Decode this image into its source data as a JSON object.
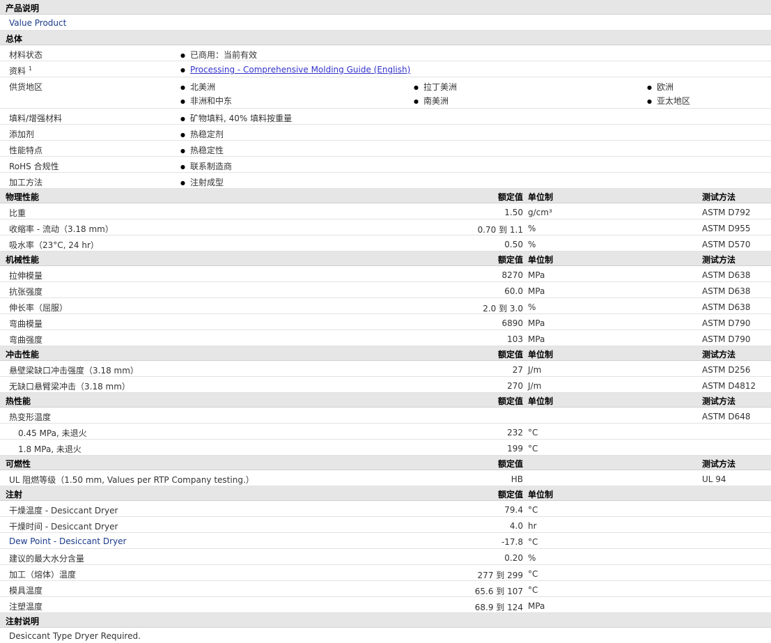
{
  "desc": {
    "title": "产品说明",
    "text": "Value Product"
  },
  "general": {
    "title": "总体",
    "rows": [
      {
        "label": "材料状态",
        "values": [
          "已商用：当前有效"
        ]
      },
      {
        "label": "资料",
        "sup": "1",
        "link": "Processing - Comprehensive Molding Guide (English)"
      },
      {
        "label": "供货地区",
        "values": [
          "北美洲",
          "拉丁美洲",
          "欧洲",
          "非洲和中东",
          "南美洲",
          "亚太地区"
        ]
      },
      {
        "label": "填料/增强材料",
        "values": [
          "矿物填料, 40% 填料按重量"
        ]
      },
      {
        "label": "添加剂",
        "values": [
          "热稳定剂"
        ]
      },
      {
        "label": "性能特点",
        "values": [
          "热稳定性"
        ]
      },
      {
        "label": "RoHS 合规性",
        "values": [
          "联系制造商"
        ]
      },
      {
        "label": "加工方法",
        "values": [
          "注射成型"
        ]
      }
    ]
  },
  "physical": {
    "title": "物理性能",
    "col_value": "额定值",
    "col_unit": "单位制",
    "col_method": "测试方法",
    "rows": [
      {
        "label": "比重",
        "value": "1.50",
        "unit": "g/cm³",
        "method": "ASTM D792"
      },
      {
        "label": "收缩率  - 流动（3.18 mm）",
        "value": "0.70 到  1.1",
        "unit": "%",
        "method": "ASTM D955"
      },
      {
        "label": "吸水率（23°C, 24 hr）",
        "value": "0.50",
        "unit": "%",
        "method": "ASTM D570"
      }
    ]
  },
  "mechanical": {
    "title": "机械性能",
    "col_value": "额定值",
    "col_unit": "单位制",
    "col_method": "测试方法",
    "rows": [
      {
        "label": "拉伸模量",
        "value": "8270",
        "unit": "MPa",
        "method": "ASTM D638"
      },
      {
        "label": "抗张强度",
        "value": "60.0",
        "unit": "MPa",
        "method": "ASTM D638"
      },
      {
        "label": "伸长率（屈服）",
        "value": "2.0 到  3.0",
        "unit": "%",
        "method": "ASTM D638"
      },
      {
        "label": "弯曲模量",
        "value": "6890",
        "unit": "MPa",
        "method": "ASTM D790"
      },
      {
        "label": "弯曲强度",
        "value": "103",
        "unit": "MPa",
        "method": "ASTM D790"
      }
    ]
  },
  "impact": {
    "title": "冲击性能",
    "col_value": "额定值",
    "col_unit": "单位制",
    "col_method": "测试方法",
    "rows": [
      {
        "label": "悬壁梁缺口冲击强度（3.18 mm）",
        "value": "27",
        "unit": "J/m",
        "method": "ASTM D256"
      },
      {
        "label": "无缺口悬臂梁冲击（3.18 mm）",
        "value": "270",
        "unit": "J/m",
        "method": "ASTM D4812"
      }
    ]
  },
  "thermal": {
    "title": "热性能",
    "col_value": "额定值",
    "col_unit": "单位制",
    "col_method": "测试方法",
    "rows": [
      {
        "label": "热变形温度",
        "value": "",
        "unit": "",
        "method": "ASTM D648"
      },
      {
        "label": "0.45 MPa, 未退火",
        "value": "232",
        "unit": "°C",
        "method": "",
        "indent": true
      },
      {
        "label": "1.8 MPa, 未退火",
        "value": "199",
        "unit": "°C",
        "method": "",
        "indent": true
      }
    ]
  },
  "flammability": {
    "title": "可燃性",
    "col_value": "额定值",
    "col_unit": "",
    "col_method": "测试方法",
    "rows": [
      {
        "label": "UL 阻燃等级（1.50 mm, Values per RTP Company testing.）",
        "value": "HB",
        "unit": "",
        "method": "UL 94"
      }
    ]
  },
  "injection": {
    "title": "注射",
    "col_value": "额定值",
    "col_unit": "单位制",
    "col_method": "",
    "rows": [
      {
        "label": "干燥温度  - Desiccant Dryer",
        "value": "79.4",
        "unit": "°C",
        "method": ""
      },
      {
        "label": "干燥时间  - Desiccant Dryer",
        "value": "4.0",
        "unit": "hr",
        "method": ""
      },
      {
        "label": "Dew Point - Desiccant Dryer",
        "value": "-17.8",
        "unit": "°C",
        "method": "",
        "blue": true
      },
      {
        "label": "建议的最大水分含量",
        "value": "0.20",
        "unit": "%",
        "method": ""
      },
      {
        "label": "加工（熔体）温度",
        "value": "277 到  299",
        "unit": "°C",
        "method": ""
      },
      {
        "label": "模具温度",
        "value": "65.6 到  107",
        "unit": "°C",
        "method": ""
      },
      {
        "label": "注塑温度",
        "value": "68.9 到  124",
        "unit": "MPa",
        "method": ""
      }
    ]
  },
  "notes": {
    "title": "注射说明",
    "text": "Desiccant Type Dryer Required."
  }
}
